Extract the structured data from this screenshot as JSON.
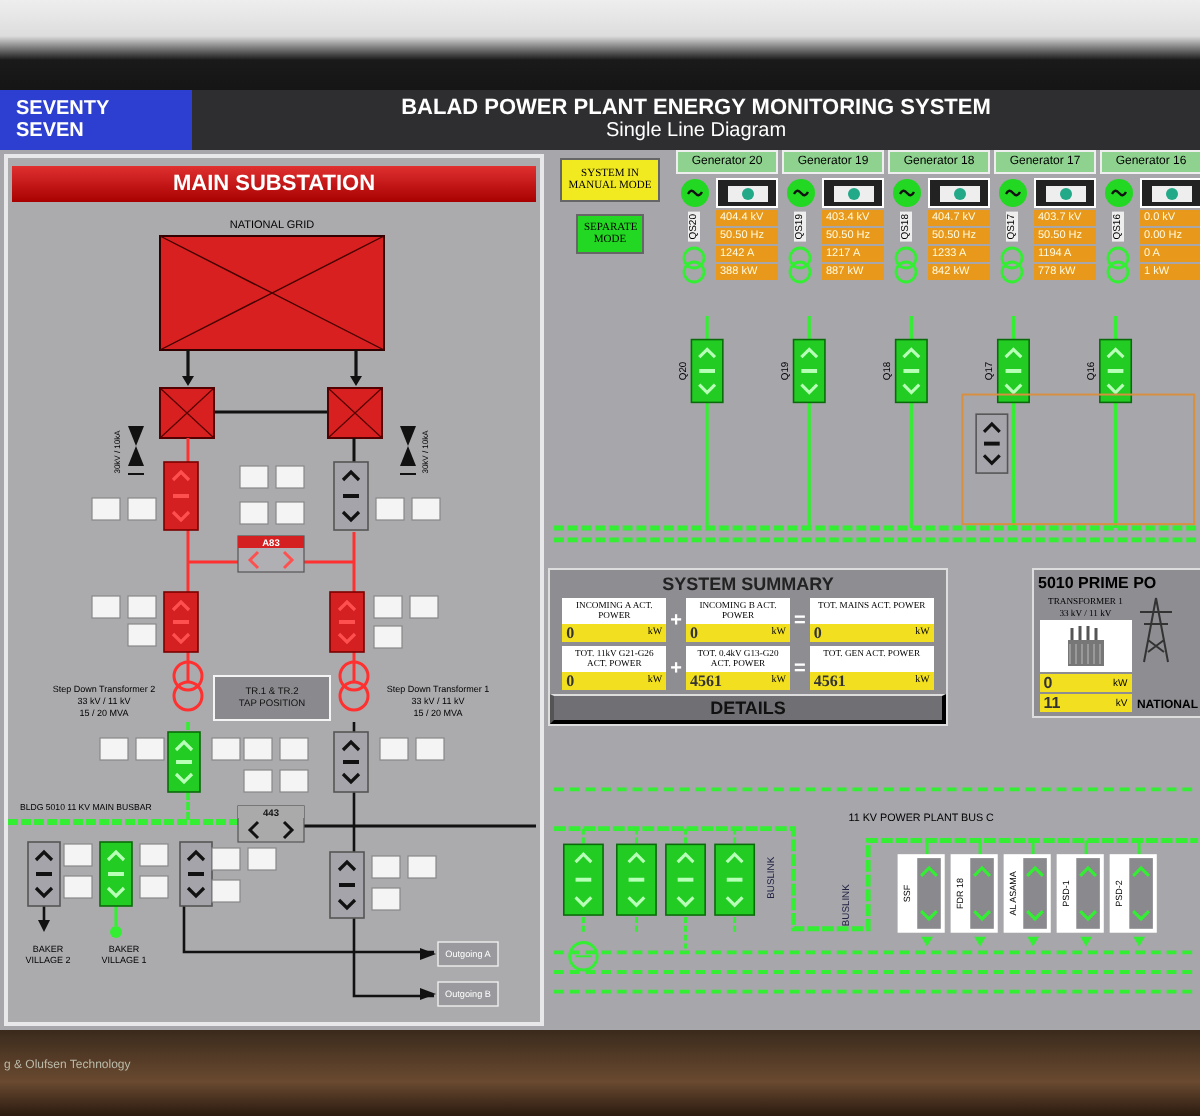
{
  "header": {
    "plant_label": "SEVENTY SEVEN",
    "title": "BALAD POWER PLANT ENERGY MONITORING SYSTEM",
    "subtitle": "Single Line Diagram"
  },
  "substation": {
    "title": "MAIN SUBSTATION",
    "grid_label": "NATIONAL GRID",
    "arrester_labels": [
      "30kV / 10kA",
      "30kV / 10kA"
    ],
    "couplers": [
      {
        "label": "A83",
        "kind": "live"
      },
      {
        "label": "443",
        "kind": "open"
      }
    ],
    "breakers": [
      {
        "kind": "live"
      },
      {
        "kind": "open"
      },
      {
        "kind": "live"
      },
      {
        "kind": "live"
      },
      {
        "kind": "energized"
      },
      {
        "kind": "open"
      },
      {
        "kind": "open"
      },
      {
        "kind": "energized"
      },
      {
        "kind": "open"
      },
      {
        "kind": "open"
      }
    ],
    "tap_button": "TR.1 & TR.2 TAP POSITION",
    "transformers": [
      {
        "name": "Step Down Transformer 2",
        "rating": "33 kV / 11 kV",
        "capacity": "15 / 20 MVA"
      },
      {
        "name": "Step Down Transformer 1",
        "rating": "33 kV / 11 kV",
        "capacity": "15 / 20 MVA"
      }
    ],
    "busbar_label": "BLDG 5010 11 KV MAIN BUSBAR",
    "villages": [
      "BAKER VILLAGE 2",
      "BAKER VILLAGE 1"
    ],
    "outgoing": [
      "Outgoing A",
      "Outgoing B"
    ]
  },
  "modes": [
    {
      "label": "SYSTEM IN MANUAL MODE",
      "kind": "manual"
    },
    {
      "label": "SEPARATE MODE",
      "kind": "separate"
    }
  ],
  "generators": [
    {
      "name": "Generator 20",
      "breaker": "QS20",
      "readings": [
        "404.4 kV",
        "50.50 Hz",
        "1242 A",
        "388 kW"
      ]
    },
    {
      "name": "Generator 19",
      "breaker": "QS19",
      "readings": [
        "403.4 kV",
        "50.50 Hz",
        "1217 A",
        "887 kW"
      ]
    },
    {
      "name": "Generator 18",
      "breaker": "QS18",
      "readings": [
        "404.7 kV",
        "50.50 Hz",
        "1233 A",
        "842 kW"
      ]
    },
    {
      "name": "Generator 17",
      "breaker": "QS17",
      "readings": [
        "403.7 kV",
        "50.50 Hz",
        "1194 A",
        "778 kW"
      ]
    },
    {
      "name": "Generator 16",
      "breaker": "QS16",
      "readings": [
        "0.0 kV",
        "0.00 Hz",
        "0 A",
        "1 kW"
      ]
    }
  ],
  "feeder_breakers": [
    "Q20",
    "Q19",
    "Q18",
    "Q17",
    "Q16"
  ],
  "summary": {
    "title": "SYSTEM SUMMARY",
    "rows": [
      {
        "terms": [
          {
            "label": "INCOMING A ACT. POWER",
            "value": "0",
            "unit": "kW"
          },
          {
            "label": "INCOMING B ACT. POWER",
            "value": "0",
            "unit": "kW"
          },
          {
            "label": "TOT. MAINS ACT. POWER",
            "value": "0",
            "unit": "kW"
          }
        ],
        "operators": [
          "+",
          "="
        ]
      },
      {
        "terms": [
          {
            "label": "TOT. 11kV G21-G26 ACT. POWER",
            "value": "0",
            "unit": "kW"
          },
          {
            "label": "TOT. 0.4kV G13-G20 ACT. POWER",
            "value": "4561",
            "unit": "kW"
          },
          {
            "label": "TOT. GEN ACT. POWER",
            "value": "4561",
            "unit": "kW"
          }
        ],
        "operators": [
          "+",
          "="
        ]
      }
    ],
    "details": "DETAILS"
  },
  "prime": {
    "title": "5010 PRIME PO",
    "transformer": "TRANSFORMER 1",
    "rating": "33 kV / 11 kV",
    "readings": [
      {
        "value": "0",
        "unit": "kW"
      },
      {
        "value": "11",
        "unit": "kV"
      }
    ],
    "grid_label": "NATIONAL"
  },
  "bus_c": {
    "label": "11 KV POWER PLANT BUS C",
    "links": [
      "BUSLINK",
      "BUSLINK"
    ],
    "feeders": [
      "SSF",
      "FDR 18",
      "AL ASAMA",
      "PSD-1",
      "PSD-2"
    ]
  },
  "bezel": {
    "text": "g & Olufsen Technology"
  }
}
